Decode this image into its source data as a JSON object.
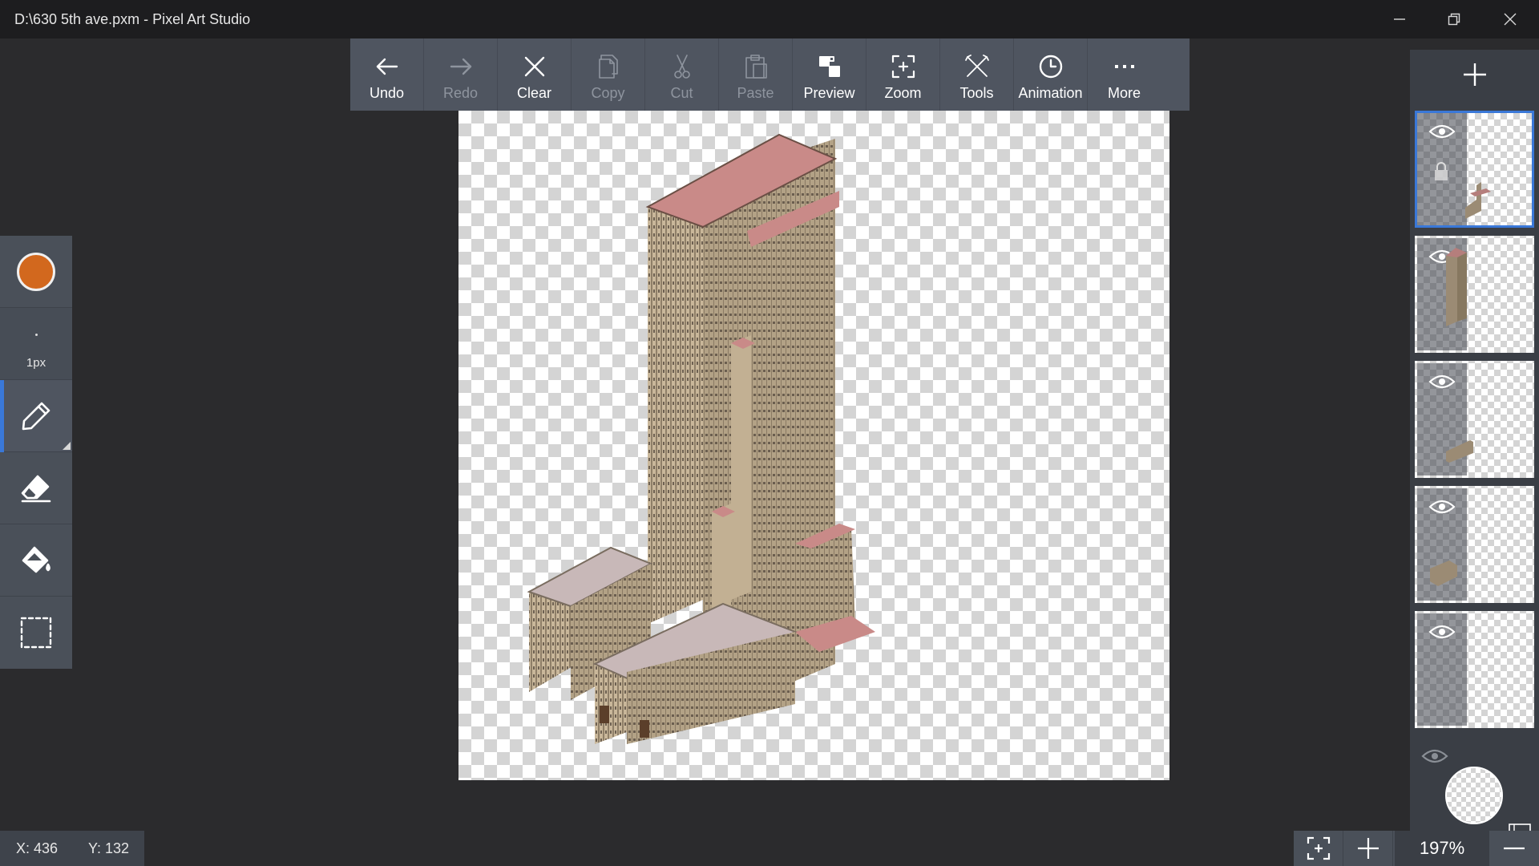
{
  "window": {
    "title": "D:\\630 5th ave.pxm - Pixel Art Studio"
  },
  "toolbar": {
    "items": [
      {
        "label": "Undo",
        "icon": "arrow-left-icon",
        "enabled": true
      },
      {
        "label": "Redo",
        "icon": "arrow-right-icon",
        "enabled": false
      },
      {
        "label": "Clear",
        "icon": "x-icon",
        "enabled": true
      },
      {
        "label": "Copy",
        "icon": "copy-icon",
        "enabled": false
      },
      {
        "label": "Cut",
        "icon": "scissors-icon",
        "enabled": false
      },
      {
        "label": "Paste",
        "icon": "clipboard-icon",
        "enabled": false
      },
      {
        "label": "Preview",
        "icon": "preview-icon",
        "enabled": true
      },
      {
        "label": "Zoom",
        "icon": "zoom-frame-icon",
        "enabled": true
      },
      {
        "label": "Tools",
        "icon": "tools-icon",
        "enabled": true
      },
      {
        "label": "Animation",
        "icon": "clock-icon",
        "enabled": true
      },
      {
        "label": "More",
        "icon": "ellipsis-icon",
        "enabled": true
      }
    ]
  },
  "leftpanel": {
    "primary_color": "#d2681e",
    "brush_size": "1px",
    "tools": [
      "pencil-icon",
      "eraser-icon",
      "paint-bucket-icon",
      "selection-icon"
    ],
    "active_tool": "pencil"
  },
  "layers": {
    "count": 5,
    "selected_index": 0,
    "background_visible": true
  },
  "status": {
    "x": "X: 436",
    "y": "Y: 132"
  },
  "zoom": {
    "level": "197%"
  },
  "colors": {
    "accent": "#3a78d8",
    "toolbar_bg": "#4f5560",
    "titlebar_bg": "#1d1d1f",
    "workspace_bg": "#2b2b2d",
    "building_roof": "#c98a88",
    "building_wall": "#c9b79a"
  }
}
